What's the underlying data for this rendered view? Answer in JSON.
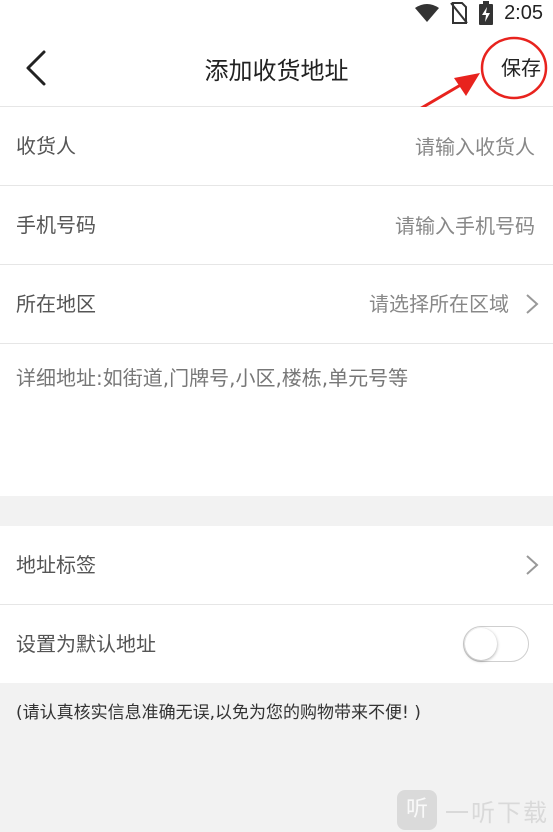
{
  "status_bar": {
    "time": "2:05"
  },
  "navbar": {
    "title": "添加收货地址",
    "save_label": "保存"
  },
  "form": {
    "consignee": {
      "label": "收货人",
      "placeholder": "请输入收货人"
    },
    "phone": {
      "label": "手机号码",
      "placeholder": "请输入手机号码"
    },
    "region": {
      "label": "所在地区",
      "placeholder": "请选择所在区域"
    },
    "detail_address": {
      "placeholder": "详细地址:如街道,门牌号,小区,楼栋,单元号等"
    }
  },
  "options": {
    "address_tag": {
      "label": "地址标签"
    },
    "default_address": {
      "label": "设置为默认地址",
      "enabled": false
    }
  },
  "notice": "(请认真核实信息准确无误,以免为您的购物带来不便! )",
  "watermark": {
    "badge": "听",
    "text": "一听下载"
  },
  "colors": {
    "annotation": "#e8231e"
  }
}
